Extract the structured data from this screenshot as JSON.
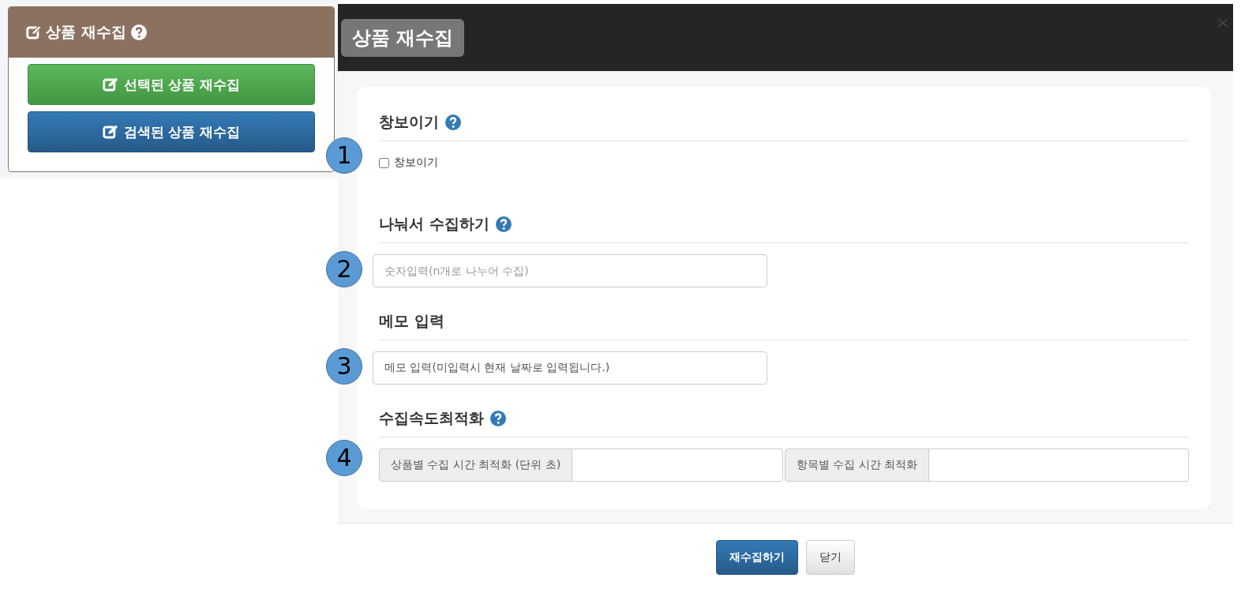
{
  "sidebar_panel": {
    "title": "상품 재수집",
    "help": true,
    "buttons": [
      {
        "label": "선택된 상품 재수집",
        "kind": "success"
      },
      {
        "label": "검색된 상품 재수집",
        "kind": "primary"
      }
    ]
  },
  "dialog": {
    "title": "상품 재수집",
    "sections": [
      {
        "marker": "1",
        "heading": "창보이기",
        "help": true,
        "kind": "checkbox",
        "label": "창보이기",
        "checked": false
      },
      {
        "marker": "2",
        "heading": "나눠서 수집하기",
        "help": true,
        "kind": "input",
        "placeholder": "숫자입력(n개로 나누어 수집)"
      },
      {
        "marker": "3",
        "heading": "메모 입력",
        "help": false,
        "kind": "input",
        "value": "메모 입력(미입력시 현재 날짜로 입력됩니다.)"
      },
      {
        "marker": "4",
        "heading": "수집속도최적화",
        "help": true,
        "kind": "addons",
        "addons": [
          "상품별 수집 시간 최적화 (단위 초)",
          "항목별 수집 시간 최적화"
        ]
      }
    ],
    "buttons": [
      {
        "label": "재수집하기",
        "kind": "primary"
      },
      {
        "label": "닫기",
        "kind": "default"
      }
    ]
  }
}
